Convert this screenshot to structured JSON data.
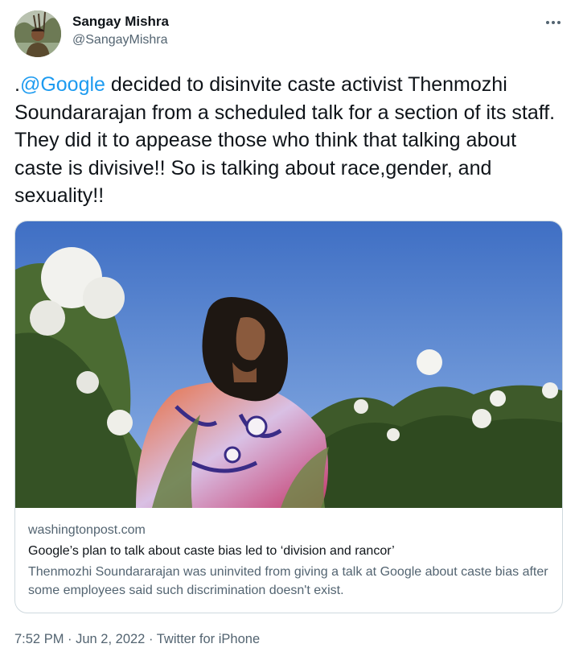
{
  "author": {
    "name": "Sangay Mishra",
    "handle": "@SangayMishra"
  },
  "tweet": {
    "prefix": ".",
    "mention": "@Google",
    "text": " decided to disinvite caste activist Thenmozhi Soundararajan from a scheduled talk for a section of its staff. They did it to appease those who think that talking about caste is divisive!! So is talking about race,gender, and sexuality!!"
  },
  "card": {
    "domain": "washingtonpost.com",
    "title": "Google’s plan to talk about caste bias led to ‘division and rancor’",
    "description": "Thenmozhi Soundararajan was uninvited from giving a talk at Google about caste bias after some employees said such discrimination doesn't exist."
  },
  "footer": {
    "time": "7:52 PM",
    "separator": " · ",
    "date": "Jun 2, 2022",
    "source": "Twitter for iPhone"
  },
  "icons": {
    "more": "more-dots-icon"
  },
  "colors": {
    "link": "#1d9bf0",
    "secondary_text": "#536471",
    "primary_text": "#0f1419",
    "card_border": "#cfd9de"
  }
}
